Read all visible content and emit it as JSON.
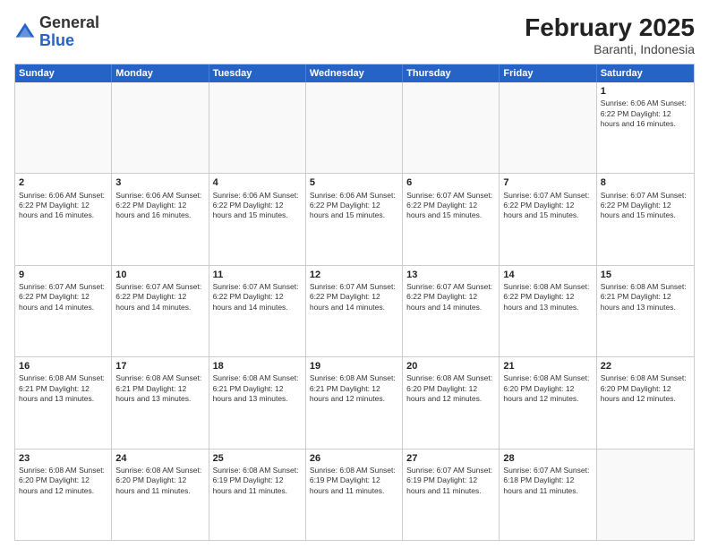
{
  "header": {
    "logo": {
      "general": "General",
      "blue": "Blue"
    },
    "month_year": "February 2025",
    "location": "Baranti, Indonesia"
  },
  "weekdays": [
    "Sunday",
    "Monday",
    "Tuesday",
    "Wednesday",
    "Thursday",
    "Friday",
    "Saturday"
  ],
  "rows": [
    [
      {
        "day": "",
        "info": ""
      },
      {
        "day": "",
        "info": ""
      },
      {
        "day": "",
        "info": ""
      },
      {
        "day": "",
        "info": ""
      },
      {
        "day": "",
        "info": ""
      },
      {
        "day": "",
        "info": ""
      },
      {
        "day": "1",
        "info": "Sunrise: 6:06 AM\nSunset: 6:22 PM\nDaylight: 12 hours\nand 16 minutes."
      }
    ],
    [
      {
        "day": "2",
        "info": "Sunrise: 6:06 AM\nSunset: 6:22 PM\nDaylight: 12 hours\nand 16 minutes."
      },
      {
        "day": "3",
        "info": "Sunrise: 6:06 AM\nSunset: 6:22 PM\nDaylight: 12 hours\nand 16 minutes."
      },
      {
        "day": "4",
        "info": "Sunrise: 6:06 AM\nSunset: 6:22 PM\nDaylight: 12 hours\nand 15 minutes."
      },
      {
        "day": "5",
        "info": "Sunrise: 6:06 AM\nSunset: 6:22 PM\nDaylight: 12 hours\nand 15 minutes."
      },
      {
        "day": "6",
        "info": "Sunrise: 6:07 AM\nSunset: 6:22 PM\nDaylight: 12 hours\nand 15 minutes."
      },
      {
        "day": "7",
        "info": "Sunrise: 6:07 AM\nSunset: 6:22 PM\nDaylight: 12 hours\nand 15 minutes."
      },
      {
        "day": "8",
        "info": "Sunrise: 6:07 AM\nSunset: 6:22 PM\nDaylight: 12 hours\nand 15 minutes."
      }
    ],
    [
      {
        "day": "9",
        "info": "Sunrise: 6:07 AM\nSunset: 6:22 PM\nDaylight: 12 hours\nand 14 minutes."
      },
      {
        "day": "10",
        "info": "Sunrise: 6:07 AM\nSunset: 6:22 PM\nDaylight: 12 hours\nand 14 minutes."
      },
      {
        "day": "11",
        "info": "Sunrise: 6:07 AM\nSunset: 6:22 PM\nDaylight: 12 hours\nand 14 minutes."
      },
      {
        "day": "12",
        "info": "Sunrise: 6:07 AM\nSunset: 6:22 PM\nDaylight: 12 hours\nand 14 minutes."
      },
      {
        "day": "13",
        "info": "Sunrise: 6:07 AM\nSunset: 6:22 PM\nDaylight: 12 hours\nand 14 minutes."
      },
      {
        "day": "14",
        "info": "Sunrise: 6:08 AM\nSunset: 6:22 PM\nDaylight: 12 hours\nand 13 minutes."
      },
      {
        "day": "15",
        "info": "Sunrise: 6:08 AM\nSunset: 6:21 PM\nDaylight: 12 hours\nand 13 minutes."
      }
    ],
    [
      {
        "day": "16",
        "info": "Sunrise: 6:08 AM\nSunset: 6:21 PM\nDaylight: 12 hours\nand 13 minutes."
      },
      {
        "day": "17",
        "info": "Sunrise: 6:08 AM\nSunset: 6:21 PM\nDaylight: 12 hours\nand 13 minutes."
      },
      {
        "day": "18",
        "info": "Sunrise: 6:08 AM\nSunset: 6:21 PM\nDaylight: 12 hours\nand 13 minutes."
      },
      {
        "day": "19",
        "info": "Sunrise: 6:08 AM\nSunset: 6:21 PM\nDaylight: 12 hours\nand 12 minutes."
      },
      {
        "day": "20",
        "info": "Sunrise: 6:08 AM\nSunset: 6:20 PM\nDaylight: 12 hours\nand 12 minutes."
      },
      {
        "day": "21",
        "info": "Sunrise: 6:08 AM\nSunset: 6:20 PM\nDaylight: 12 hours\nand 12 minutes."
      },
      {
        "day": "22",
        "info": "Sunrise: 6:08 AM\nSunset: 6:20 PM\nDaylight: 12 hours\nand 12 minutes."
      }
    ],
    [
      {
        "day": "23",
        "info": "Sunrise: 6:08 AM\nSunset: 6:20 PM\nDaylight: 12 hours\nand 12 minutes."
      },
      {
        "day": "24",
        "info": "Sunrise: 6:08 AM\nSunset: 6:20 PM\nDaylight: 12 hours\nand 11 minutes."
      },
      {
        "day": "25",
        "info": "Sunrise: 6:08 AM\nSunset: 6:19 PM\nDaylight: 12 hours\nand 11 minutes."
      },
      {
        "day": "26",
        "info": "Sunrise: 6:08 AM\nSunset: 6:19 PM\nDaylight: 12 hours\nand 11 minutes."
      },
      {
        "day": "27",
        "info": "Sunrise: 6:07 AM\nSunset: 6:19 PM\nDaylight: 12 hours\nand 11 minutes."
      },
      {
        "day": "28",
        "info": "Sunrise: 6:07 AM\nSunset: 6:18 PM\nDaylight: 12 hours\nand 11 minutes."
      },
      {
        "day": "",
        "info": ""
      }
    ]
  ]
}
